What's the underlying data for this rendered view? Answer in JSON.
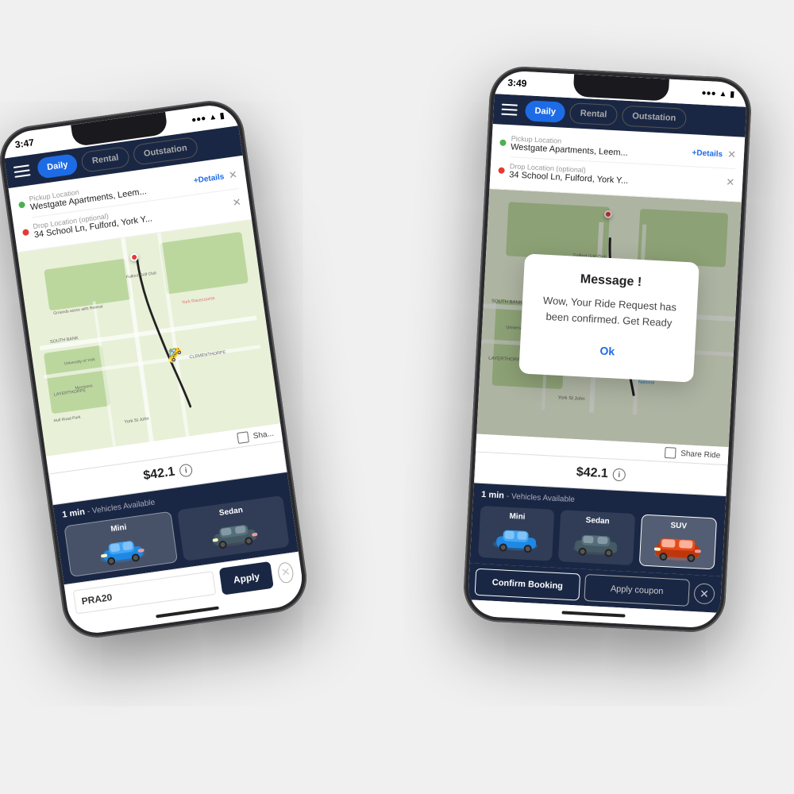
{
  "scene": {
    "background": "#e8e8e8"
  },
  "phone_left": {
    "status": {
      "time": "3:47",
      "icons": "●●● ▲ ■"
    },
    "tabs": {
      "daily": "Daily",
      "rental": "Rental",
      "outstation": "Outstation",
      "active": "Daily"
    },
    "pickup": {
      "label": "Pickup Location",
      "value": "Westgate Apartments, Leem...",
      "details": "+Details"
    },
    "drop": {
      "label": "Drop Location (optional)",
      "value": "34 School Ln, Fulford, York Y..."
    },
    "price": "$42.1",
    "vehicles_header_time": "1 min",
    "vehicles_header_text": "- Vehicles Available",
    "vehicles": [
      {
        "name": "Mini",
        "active": true
      },
      {
        "name": "Sedan",
        "active": false
      }
    ],
    "coupon_placeholder": "PRA20",
    "apply_label": "Apply"
  },
  "phone_right": {
    "status": {
      "time": "3:49",
      "icons": "●●● ▲ ■"
    },
    "tabs": {
      "daily": "Daily",
      "rental": "Rental",
      "outstation": "Outstation",
      "active": "Daily"
    },
    "pickup": {
      "label": "Pickup Location",
      "value": "Westgate Apartments, Leem...",
      "details": "+Details"
    },
    "drop": {
      "label": "Drop Location (optional)",
      "value": "34 School Ln, Fulford, York Y..."
    },
    "price": "$42.1",
    "share_ride": "Share Ride",
    "vehicles_header_time": "1 min",
    "vehicles_header_text": "- Vehicles Available",
    "vehicles": [
      {
        "name": "Mini",
        "active": false
      },
      {
        "name": "Sedan",
        "active": false
      },
      {
        "name": "SUV",
        "active": true
      }
    ],
    "confirm_booking": "Confirm Booking",
    "apply_coupon": "Apply coupon",
    "modal": {
      "title": "Message !",
      "message": "Wow, Your Ride Request has been confirmed. Get Ready",
      "ok": "Ok"
    }
  }
}
